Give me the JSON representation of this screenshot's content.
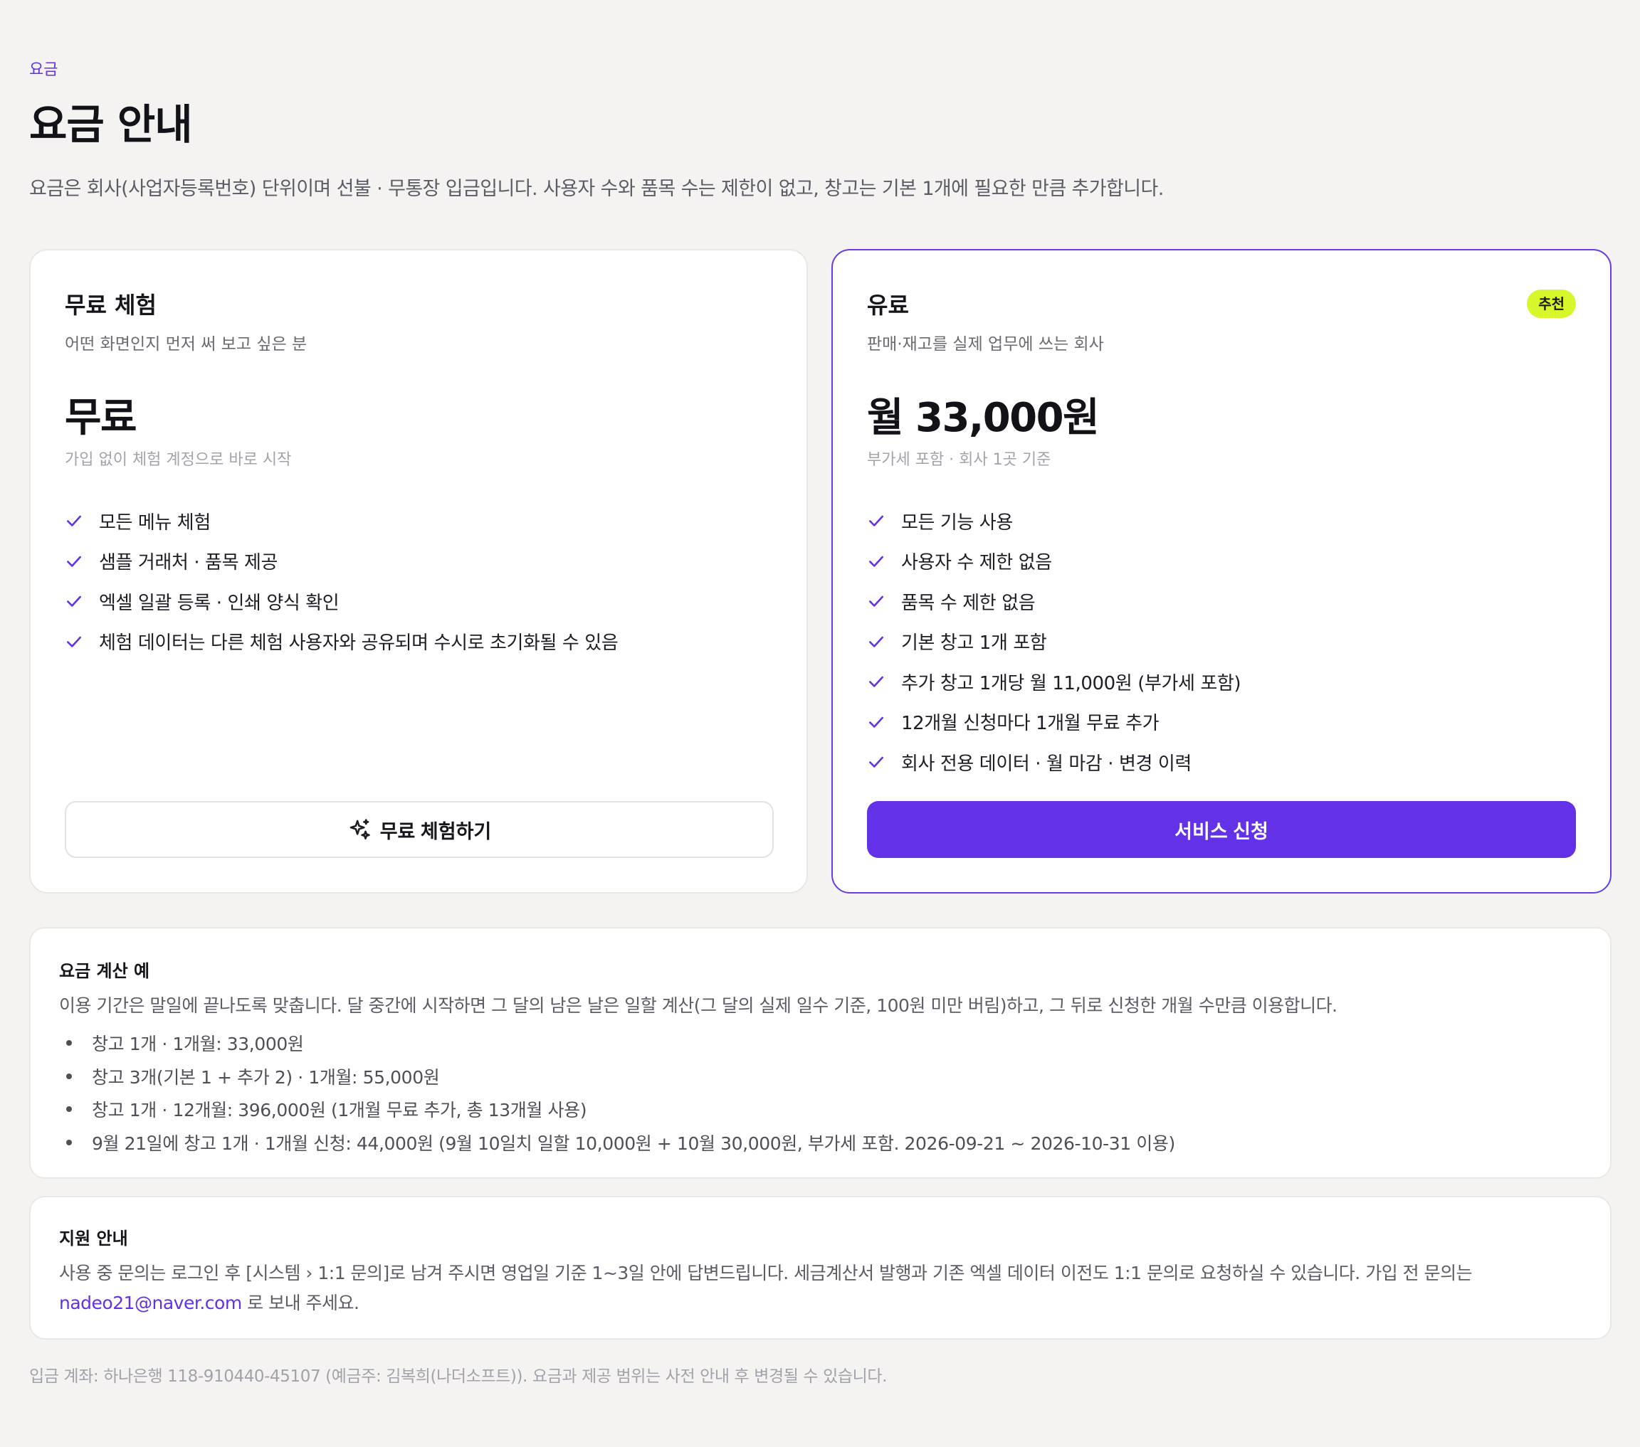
{
  "header": {
    "eyebrow": "요금",
    "title": "요금 안내",
    "intro": "요금은 회사(사업자등록번호) 단위이며 선불 · 무통장 입금입니다. 사용자 수와 품목 수는 제한이 없고, 창고는 기본 1개에 필요한 만큼 추가합니다."
  },
  "plans": {
    "free": {
      "name": "무료 체험",
      "subtitle": "어떤 화면인지 먼저 써 보고 싶은 분",
      "price": "무료",
      "price_note": "가입 없이 체험 계정으로 바로 시작",
      "features": [
        "모든 메뉴 체험",
        "샘플 거래처 · 품목 제공",
        "엑셀 일괄 등록 · 인쇄 양식 확인",
        "체험 데이터는 다른 체험 사용자와 공유되며 수시로 초기화될 수 있음"
      ],
      "cta_label": "무료 체험하기",
      "cta_icon": "sparkles-icon"
    },
    "paid": {
      "name": "유료",
      "badge": "추천",
      "subtitle": "판매·재고를 실제 업무에 쓰는 회사",
      "price": "월 33,000원",
      "price_note": "부가세 포함 · 회사 1곳 기준",
      "features": [
        "모든 기능 사용",
        "사용자 수 제한 없음",
        "품목 수 제한 없음",
        "기본 창고 1개 포함",
        "추가 창고 1개당 월 11,000원 (부가세 포함)",
        "12개월 신청마다 1개월 무료 추가",
        "회사 전용 데이터 · 월 마감 · 변경 이력"
      ],
      "cta_label": "서비스 신청"
    }
  },
  "calc": {
    "title": "요금 계산 예",
    "description": "이용 기간은 말일에 끝나도록 맞춥니다. 달 중간에 시작하면 그 달의 남은 날은 일할 계산(그 달의 실제 일수 기준, 100원 미만 버림)하고, 그 뒤로 신청한 개월 수만큼 이용합니다.",
    "examples": [
      "창고 1개 · 1개월: 33,000원",
      "창고 3개(기본 1 + 추가 2) · 1개월: 55,000원",
      "창고 1개 · 12개월: 396,000원 (1개월 무료 추가, 총 13개월 사용)",
      "9월 21일에 창고 1개 · 1개월 신청: 44,000원 (9월 10일치 일할 10,000원 + 10월 30,000원, 부가세 포함. 2026-09-21 ~ 2026-10-31 이용)"
    ]
  },
  "support": {
    "title": "지원 안내",
    "text_line1": "사용 중 문의는 로그인 후 [시스템 › 1:1 문의]로 남겨 주시면 영업일 기준 1~3일 안에 답변드립니다. 세금계산서 발행과 기존 엑셀 데이터 이전도 1:1 문의로 요청하실 수 있습니다. 가입 전 문의는",
    "email": "nadeo21@naver.com",
    "text_after_email": " 로 보내 주세요."
  },
  "footer": {
    "note": "입금 계좌: 하나은행 118-910440-45107 (예금주: 김복희(나더소프트)). 요금과 제공 범위는 사전 안내 후 변경될 수 있습니다."
  },
  "colors": {
    "accent": "#6231e8",
    "badge": "#d8f72b",
    "background": "#f4f3f2"
  }
}
